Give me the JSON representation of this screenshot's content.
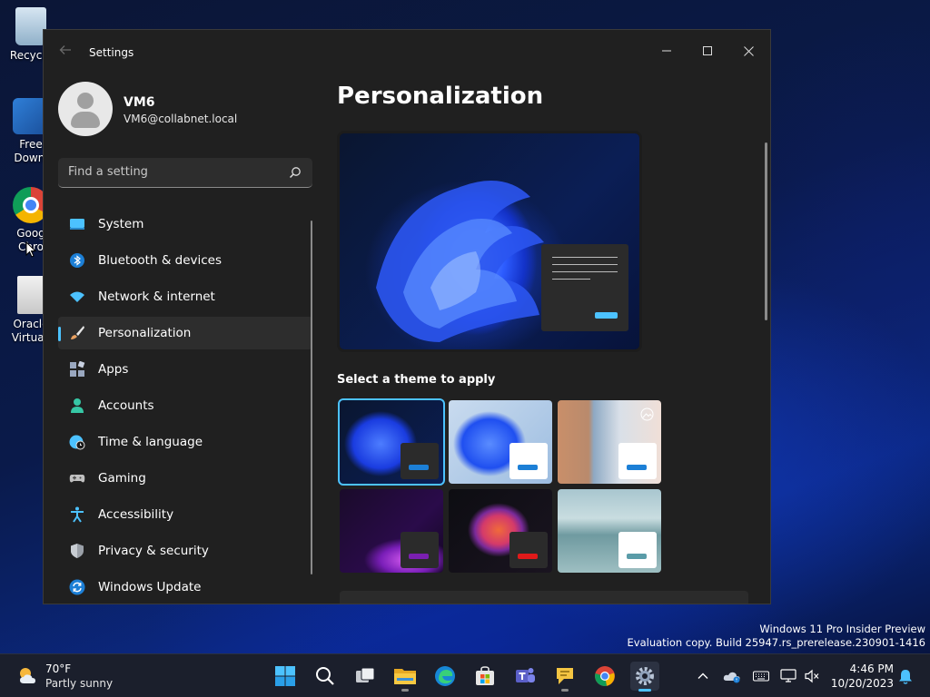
{
  "desktop": {
    "icons": [
      {
        "label": "Recycle"
      },
      {
        "label": "Free",
        "label2": "Downl"
      },
      {
        "label": "Goog",
        "label2": "Chro"
      },
      {
        "label": "Oracle",
        "label2": "Virtuall"
      }
    ]
  },
  "window": {
    "title": "Settings",
    "back_icon": "back-arrow-icon",
    "controls": [
      "minimize-icon",
      "maximize-icon",
      "close-icon"
    ]
  },
  "user": {
    "name": "VM6",
    "email": "VM6@collabnet.local"
  },
  "search": {
    "placeholder": "Find a setting",
    "value": ""
  },
  "nav": {
    "items": [
      {
        "label": "System",
        "icon": "monitor-icon",
        "color": "#4cc2ff"
      },
      {
        "label": "Bluetooth & devices",
        "icon": "bluetooth-icon",
        "color": "#4cc2ff"
      },
      {
        "label": "Network & internet",
        "icon": "wifi-icon",
        "color": "#4cc2ff"
      },
      {
        "label": "Personalization",
        "icon": "paintbrush-icon",
        "color": "#e8a060",
        "selected": true
      },
      {
        "label": "Apps",
        "icon": "apps-icon",
        "color": "#9aa8c0"
      },
      {
        "label": "Accounts",
        "icon": "person-icon",
        "color": "#36c7a5"
      },
      {
        "label": "Time & language",
        "icon": "globe-clock-icon",
        "color": "#4cc2ff"
      },
      {
        "label": "Gaming",
        "icon": "gamepad-icon",
        "color": "#c0c0c0"
      },
      {
        "label": "Accessibility",
        "icon": "accessibility-icon",
        "color": "#4cc2ff"
      },
      {
        "label": "Privacy & security",
        "icon": "shield-icon",
        "color": "#9aa0a8"
      },
      {
        "label": "Windows Update",
        "icon": "update-icon",
        "color": "#4cc2ff"
      }
    ]
  },
  "main": {
    "title": "Personalization",
    "theme_section_label": "Select a theme to apply",
    "themes": [
      {
        "name": "windows-dark",
        "selected": true
      },
      {
        "name": "windows-light"
      },
      {
        "name": "windows-spotlight"
      },
      {
        "name": "glow"
      },
      {
        "name": "captured-motion"
      },
      {
        "name": "flow"
      }
    ]
  },
  "watermark": {
    "line1": "Windows 11 Pro Insider Preview",
    "line2": "Evaluation copy. Build 25947.rs_prerelease.230901-1416"
  },
  "taskbar": {
    "weather": {
      "temp": "70°F",
      "condition": "Partly sunny"
    },
    "apps": [
      "start-icon",
      "search-icon",
      "task-view-icon",
      "file-explorer-icon",
      "edge-icon",
      "store-icon",
      "teams-icon",
      "feedback-hub-icon",
      "chrome-icon",
      "settings-icon"
    ],
    "tray": [
      "chevron-up-icon",
      "onedrive-icon",
      "keyboard-icon",
      "display-icon",
      "speaker-muted-icon"
    ],
    "time": "4:46 PM",
    "date": "10/20/2023",
    "notification_icon": "bell-icon"
  }
}
